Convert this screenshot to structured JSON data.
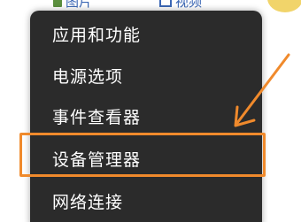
{
  "background_toolbar": {
    "items": [
      {
        "label": "图片",
        "icon": "image-icon"
      },
      {
        "label": "视频",
        "icon": "video-icon"
      }
    ],
    "avatar": "avatar-icon"
  },
  "context_menu": {
    "items": [
      {
        "label": "应用和功能"
      },
      {
        "label": "电源选项"
      },
      {
        "label": "事件查看器"
      },
      {
        "label": "设备管理器",
        "highlighted": true
      },
      {
        "label": "网络连接"
      }
    ]
  },
  "annotation": {
    "highlight_color": "#f08a2c",
    "arrow_color": "#f08a2c"
  }
}
